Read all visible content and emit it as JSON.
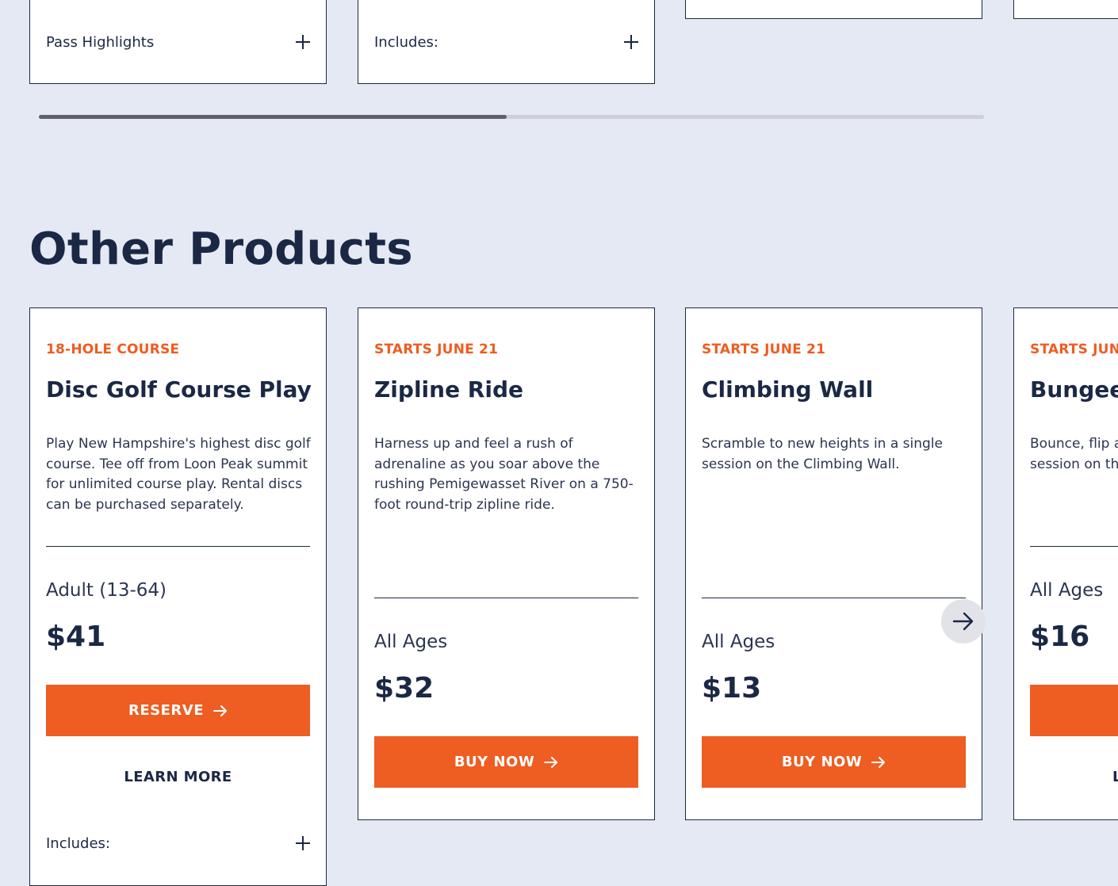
{
  "top_row": {
    "cards": [
      {
        "accordion_label": "Pass Highlights"
      },
      {
        "accordion_label": "Includes:"
      }
    ]
  },
  "section": {
    "title": "Other Products"
  },
  "scroll": {
    "progress_fraction": 0.495
  },
  "products": [
    {
      "eyebrow": "18-HOLE COURSE",
      "title": "Disc Golf Course Play",
      "description": "Play New Hampshire's highest disc golf course. Tee off from Loon Peak summit for unlimited course play. Rental discs can be purchased separately.",
      "age": "Adult (13-64)",
      "price": "$41",
      "button_label": "RESERVE",
      "learn_more": "LEARN MORE",
      "accordion_label": "Includes:"
    },
    {
      "eyebrow": "STARTS JUNE 21",
      "title": "Zipline Ride",
      "description": "Harness up and feel a rush of adrenaline as you soar above the rushing Pemigewasset River on a 750-foot round-trip zipline ride.",
      "age": "All Ages",
      "price": "$32",
      "button_label": "BUY NOW"
    },
    {
      "eyebrow": "STARTS JUNE 21",
      "title": "Climbing Wall",
      "description": "Scramble to new heights in a single session on the Climbing Wall.",
      "age": "All Ages",
      "price": "$13",
      "button_label": "BUY NOW"
    },
    {
      "eyebrow": "STARTS JUN",
      "title": "Bungee",
      "description_line1": "Bounce, flip a",
      "description_line2": "session on th",
      "age": "All Ages",
      "price": "$16",
      "learn_more": "L"
    }
  ],
  "colors": {
    "accent": "#ee5d21",
    "navy": "#1b2845",
    "background": "#e5e9f4"
  },
  "icons": {
    "accordion": "plus-icon",
    "button": "arrow-right-icon",
    "carousel_next": "arrow-right-icon"
  }
}
